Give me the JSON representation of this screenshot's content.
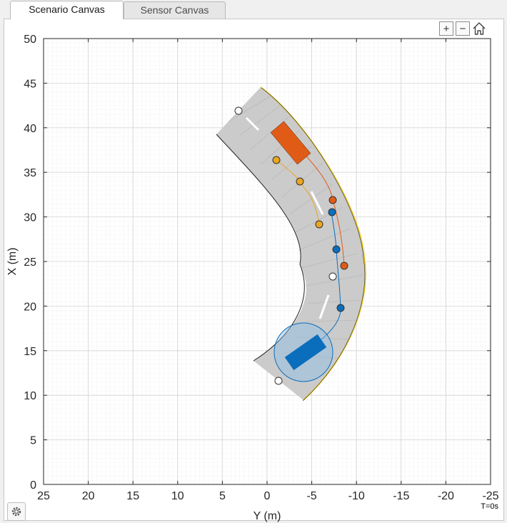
{
  "tabs": [
    {
      "label": "Scenario Canvas",
      "active": true
    },
    {
      "label": "Sensor Canvas",
      "active": false
    }
  ],
  "toolbar": {
    "zoom_in": "+",
    "zoom_out": "−",
    "zoom_in_icon": "zoom-in-icon",
    "zoom_out_icon": "zoom-out-icon",
    "home_icon": "home-icon"
  },
  "axes": {
    "xlabel": "Y (m)",
    "ylabel": "X (m)",
    "x_ticks": [
      "25",
      "20",
      "15",
      "10",
      "5",
      "0",
      "-5",
      "-10",
      "-15",
      "-20",
      "-25"
    ],
    "y_ticks": [
      "50",
      "45",
      "40",
      "35",
      "30",
      "25",
      "20",
      "15",
      "10",
      "5",
      "0"
    ]
  },
  "status": {
    "time": "T=0s"
  },
  "colors": {
    "road": "#cbcbcb",
    "road_edge_right": "#e8c20a",
    "ego_car": "#0a6ebd",
    "target_car": "#e05c16",
    "target_waypoints": "#eaa620",
    "panel_bg": "#ffffff"
  }
}
